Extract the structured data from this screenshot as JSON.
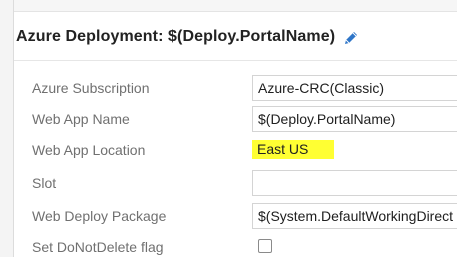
{
  "header": {
    "title": "Azure Deployment: $(Deploy.PortalName)",
    "edit_icon": "pencil-icon",
    "accent_color": "#2e75c8"
  },
  "fields": {
    "azure_subscription": {
      "label": "Azure Subscription",
      "value": "Azure-CRC(Classic)"
    },
    "web_app_name": {
      "label": "Web App Name",
      "value": "$(Deploy.PortalName)"
    },
    "web_app_location": {
      "label": "Web App Location",
      "value": "East US",
      "highlight_color": "#ffff33"
    },
    "slot": {
      "label": "Slot",
      "value": ""
    },
    "web_deploy_package": {
      "label": "Web Deploy Package",
      "value": "$(System.DefaultWorkingDirect"
    },
    "set_donotdelete_flag": {
      "label": "Set DoNotDelete flag",
      "checked": false
    }
  }
}
